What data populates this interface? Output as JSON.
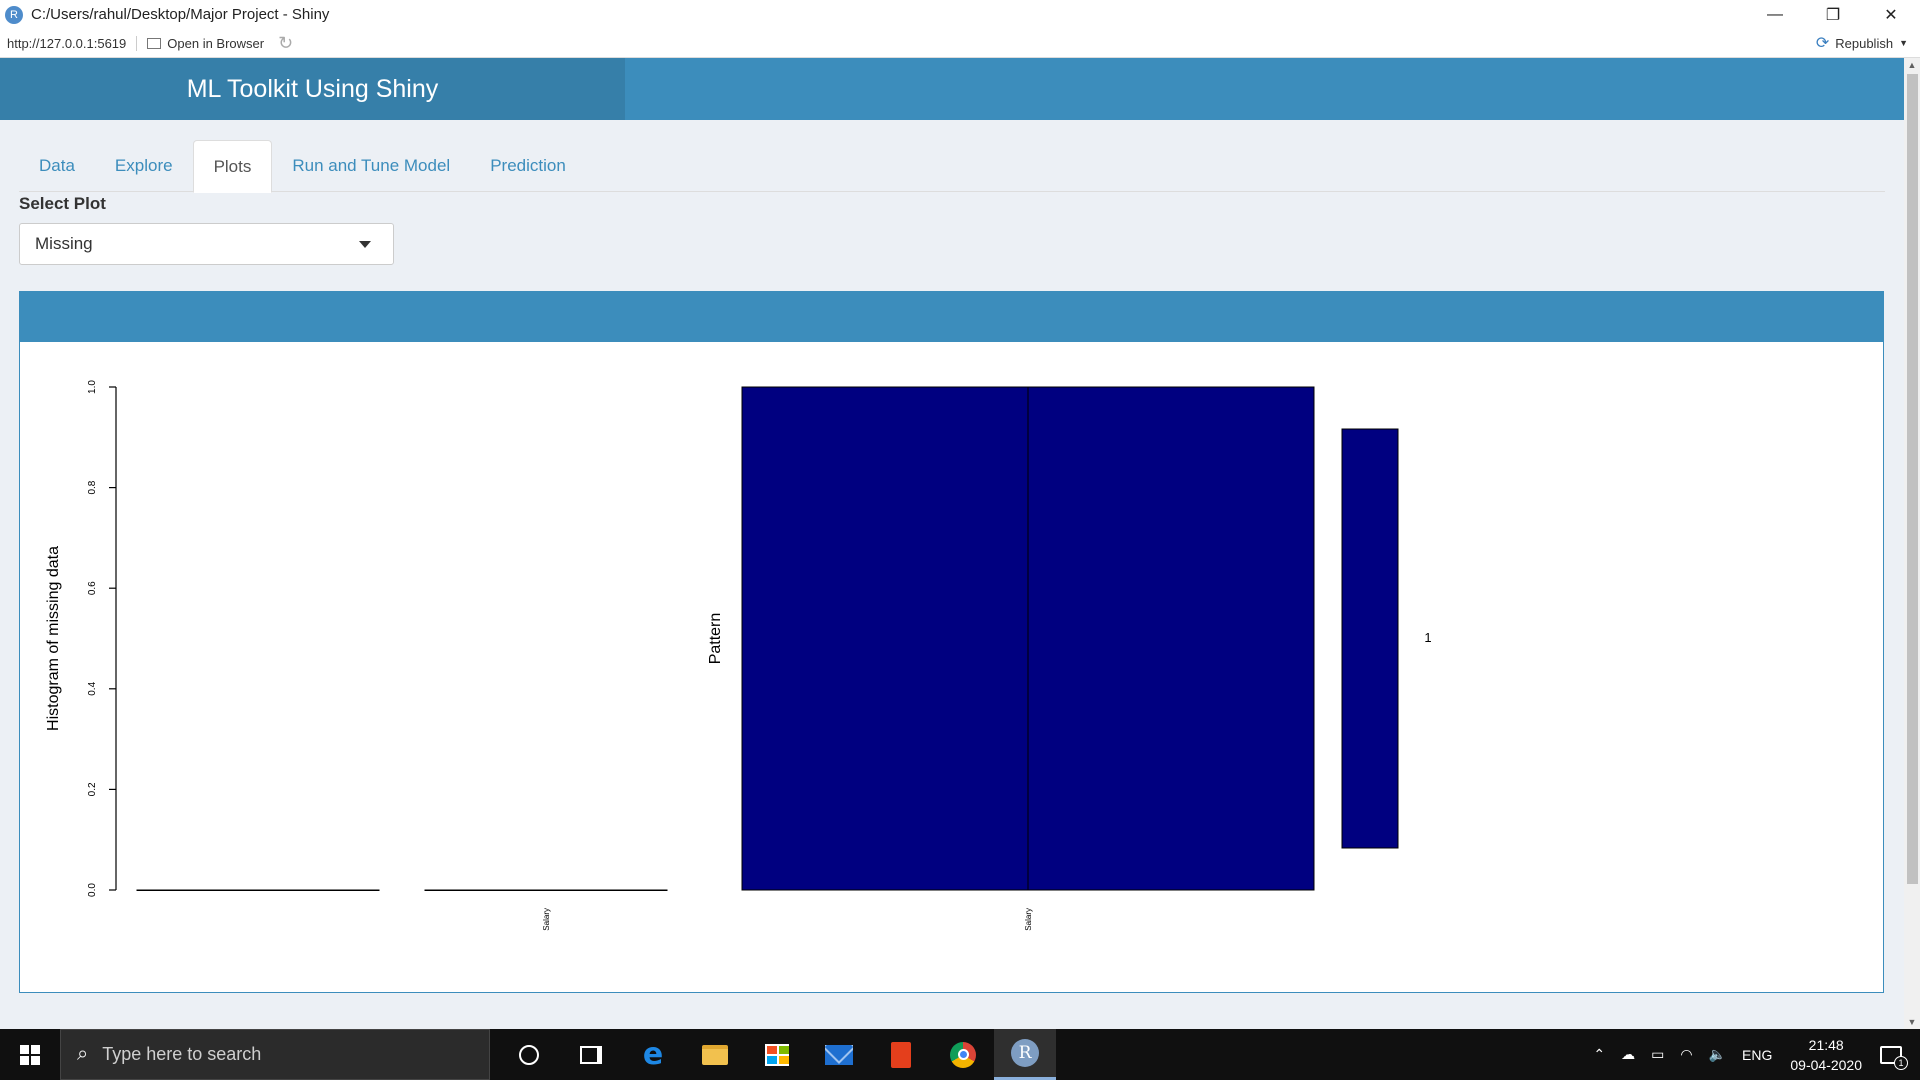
{
  "window": {
    "app_icon": "R",
    "title": "C:/Users/rahul/Desktop/Major Project - Shiny",
    "controls": {
      "minimize": "—",
      "restore": "❐",
      "close": "✕"
    }
  },
  "addressbar": {
    "url": "http://127.0.0.1:5619",
    "open_browser": "Open in Browser",
    "republish": "Republish"
  },
  "app": {
    "title": "ML Toolkit Using Shiny",
    "tabs": [
      {
        "label": "Data",
        "active": false
      },
      {
        "label": "Explore",
        "active": false
      },
      {
        "label": "Plots",
        "active": true
      },
      {
        "label": "Run and Tune Model",
        "active": false
      },
      {
        "label": "Prediction",
        "active": false
      }
    ],
    "select_label": "Select Plot",
    "select_value": "Missing"
  },
  "chart_data": [
    {
      "type": "bar",
      "ylabel": "Histogram of missing data",
      "ylim": [
        0,
        1
      ],
      "yticks": [
        "0.0",
        "0.2",
        "0.4",
        "0.6",
        "0.8",
        "1.0"
      ],
      "categories": [
        "",
        "Salary"
      ],
      "values": [
        0,
        0
      ]
    },
    {
      "type": "heatmap",
      "ylabel": "Pattern",
      "x_labels": [
        "Salary"
      ],
      "cells": [
        [
          1,
          1
        ]
      ],
      "cell_color": "#000080",
      "pattern_proportion": 1,
      "pattern_label": "1"
    }
  ],
  "colors": {
    "header": "#3c8dbc",
    "logo_bg": "#367fa9",
    "cell": "#000080"
  },
  "taskbar": {
    "search_placeholder": "Type here to search",
    "lang": "ENG",
    "time": "21:48",
    "date": "09-04-2020",
    "notifications": "1",
    "icons": [
      "cortana-icon",
      "task-view-icon",
      "edge-icon",
      "file-explorer-icon",
      "store-icon",
      "mail-icon",
      "office-icon",
      "chrome-icon",
      "r-icon"
    ]
  }
}
